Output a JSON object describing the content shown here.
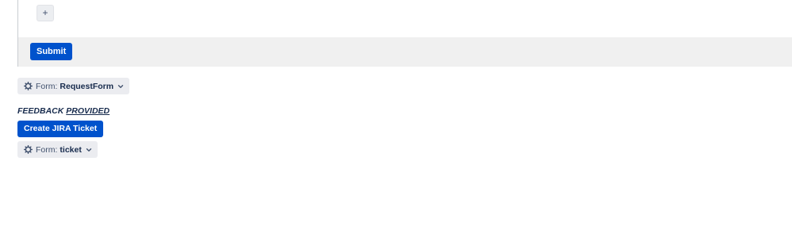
{
  "form_panel": {
    "add_label": "+",
    "submit_label": "Submit"
  },
  "request_form_chip": {
    "prefix": "Form:",
    "name": "RequestForm",
    "icon": "gear-icon"
  },
  "feedback": {
    "word1": "FEEDBACK",
    "word2": "PROVIDED"
  },
  "create_ticket_label": "Create JIRA Ticket",
  "ticket_chip": {
    "prefix": "Form:",
    "name": "ticket",
    "icon": "gear-icon"
  },
  "colors": {
    "primary": "#0052cc",
    "chip_bg": "#ebecf0",
    "footer_bg": "#f0f0f0",
    "text_dark": "#172b4d"
  }
}
